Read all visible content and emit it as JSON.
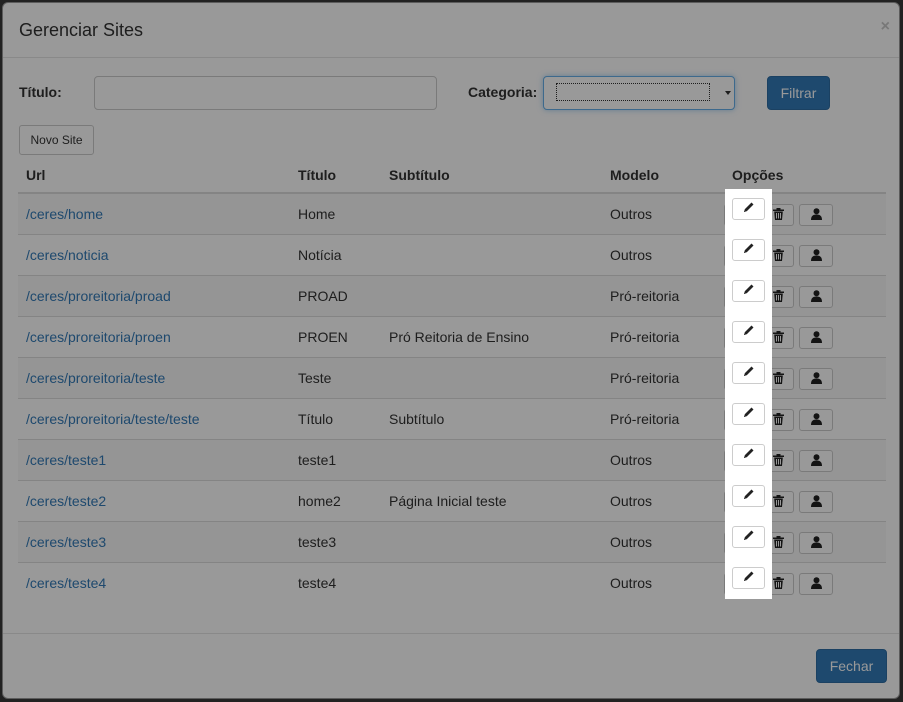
{
  "modal": {
    "title": "Gerenciar Sites",
    "close_label": "×"
  },
  "filters": {
    "titulo_label": "Título:",
    "titulo_value": "",
    "categoria_label": "Categoria:",
    "categoria_value": "",
    "filtrar_label": "Filtrar"
  },
  "novo_site_label": "Novo Site",
  "table": {
    "headers": [
      "Url",
      "Título",
      "Subtítulo",
      "Modelo",
      "Opções"
    ],
    "rows": [
      {
        "url": "/ceres/home",
        "titulo": "Home",
        "subtitulo": "",
        "modelo": "Outros"
      },
      {
        "url": "/ceres/noticia",
        "titulo": "Notícia",
        "subtitulo": "",
        "modelo": "Outros"
      },
      {
        "url": "/ceres/proreitoria/proad",
        "titulo": "PROAD",
        "subtitulo": "",
        "modelo": "Pró-reitoria"
      },
      {
        "url": "/ceres/proreitoria/proen",
        "titulo": "PROEN",
        "subtitulo": "Pró Reitoria de Ensino",
        "modelo": "Pró-reitoria"
      },
      {
        "url": "/ceres/proreitoria/teste",
        "titulo": "Teste",
        "subtitulo": "",
        "modelo": "Pró-reitoria"
      },
      {
        "url": "/ceres/proreitoria/teste/teste",
        "titulo": "Título",
        "subtitulo": "Subtítulo",
        "modelo": "Pró-reitoria"
      },
      {
        "url": "/ceres/teste1",
        "titulo": "teste1",
        "subtitulo": "",
        "modelo": "Outros"
      },
      {
        "url": "/ceres/teste2",
        "titulo": "home2",
        "subtitulo": "Página Inicial teste",
        "modelo": "Outros"
      },
      {
        "url": "/ceres/teste3",
        "titulo": "teste3",
        "subtitulo": "",
        "modelo": "Outros"
      },
      {
        "url": "/ceres/teste4",
        "titulo": "teste4",
        "subtitulo": "",
        "modelo": "Outros"
      }
    ],
    "row_icons": [
      "pencil-icon",
      "trash-icon",
      "user-icon"
    ]
  },
  "footer": {
    "fechar_label": "Fechar"
  },
  "colors": {
    "primary": "#337ab7",
    "link": "#337ab7",
    "overlay": "rgba(0,0,0,0.4)"
  }
}
